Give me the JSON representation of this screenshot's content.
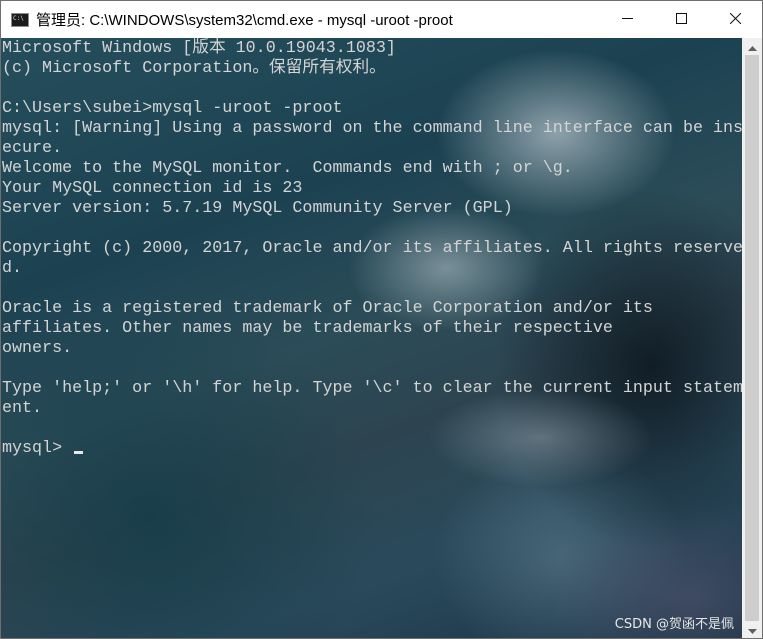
{
  "window": {
    "title": "管理员: C:\\WINDOWS\\system32\\cmd.exe - mysql  -uroot -proot",
    "icon_label": "C:\\",
    "buttons": [
      {
        "name": "minimize",
        "icon": "minimize-icon"
      },
      {
        "name": "maximize",
        "icon": "maximize-icon"
      },
      {
        "name": "close",
        "icon": "close-icon"
      }
    ]
  },
  "console": {
    "lines": [
      "Microsoft Windows [版本 10.0.19043.1083]",
      "(c) Microsoft Corporation。保留所有权利。",
      "",
      "C:\\Users\\subei>mysql -uroot -proot",
      "mysql: [Warning] Using a password on the command line interface can be ins",
      "ecure.",
      "Welcome to the MySQL monitor.  Commands end with ; or \\g.",
      "Your MySQL connection id is 23",
      "Server version: 5.7.19 MySQL Community Server (GPL)",
      "",
      "Copyright (c) 2000, 2017, Oracle and/or its affiliates. All rights reserve",
      "d.",
      "",
      "Oracle is a registered trademark of Oracle Corporation and/or its",
      "affiliates. Other names may be trademarks of their respective",
      "owners.",
      "",
      "Type 'help;' or '\\h' for help. Type '\\c' to clear the current input statem",
      "ent.",
      ""
    ],
    "prompt": "mysql> "
  },
  "watermark": "CSDN @贺函不是佩",
  "colors": {
    "console_text": "#d4d4d4",
    "titlebar_bg": "#ffffff",
    "scrollbar_bg": "#f0f0f0",
    "scrollbar_thumb": "#cdcdcd"
  }
}
